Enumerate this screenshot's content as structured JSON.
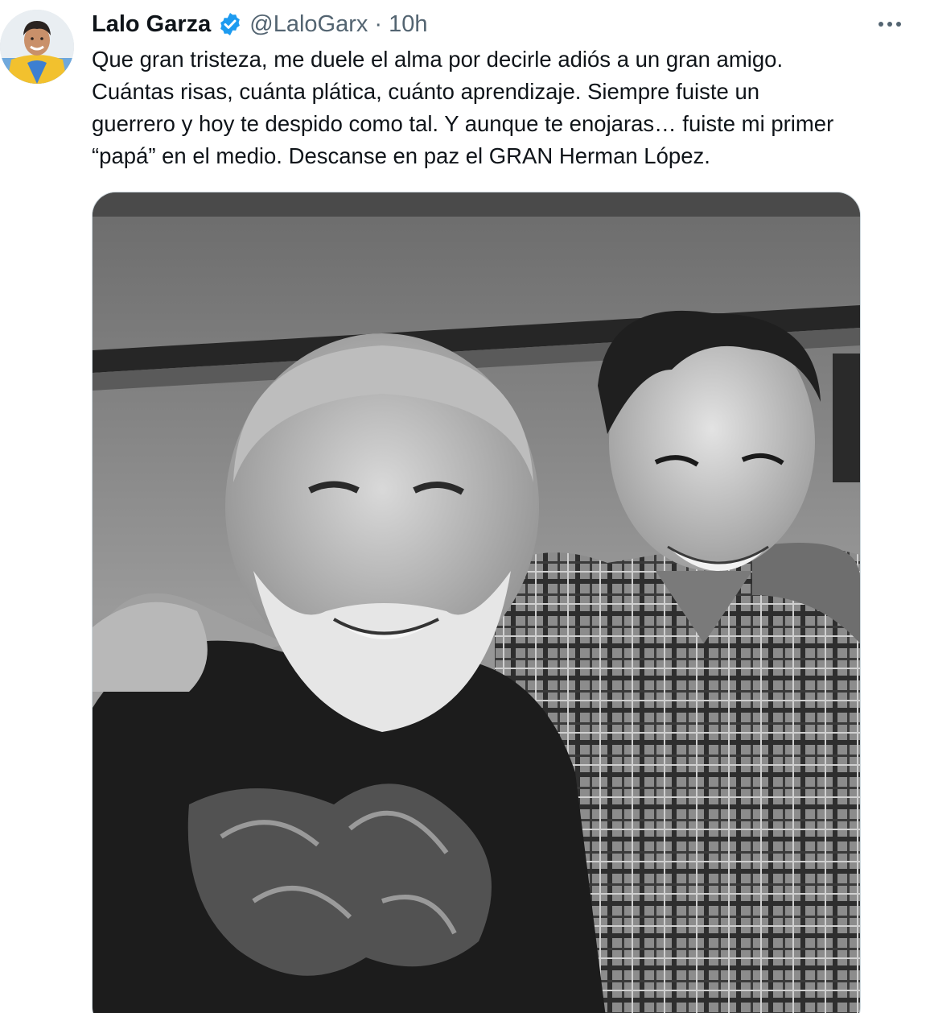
{
  "tweet": {
    "author": {
      "display_name": "Lalo Garza",
      "handle": "@LaloGarx",
      "verified": true,
      "avatar_icon": "profile-photo"
    },
    "separator": "·",
    "time": "10h",
    "more_icon": "more-horizontal-icon",
    "text_lines": [
      "Que gran tristeza, me duele el alma por decirle adiós a un gran amigo.",
      "Cuántas risas, cuánta plática, cuánto aprendizaje. Siempre fuiste un",
      "guerrero y hoy te despido como tal. Y aunque te enojaras… fuiste mi primer",
      "“papá” en el medio. Descanse en paz el GRAN Herman López."
    ],
    "media": {
      "type": "photo",
      "style": "black-and-white",
      "description_icon": "photo-two-men-smiling"
    }
  },
  "colors": {
    "text_primary": "#0f1419",
    "text_secondary": "#536471",
    "verified_blue": "#1d9bf0",
    "border": "#cfd9de"
  }
}
